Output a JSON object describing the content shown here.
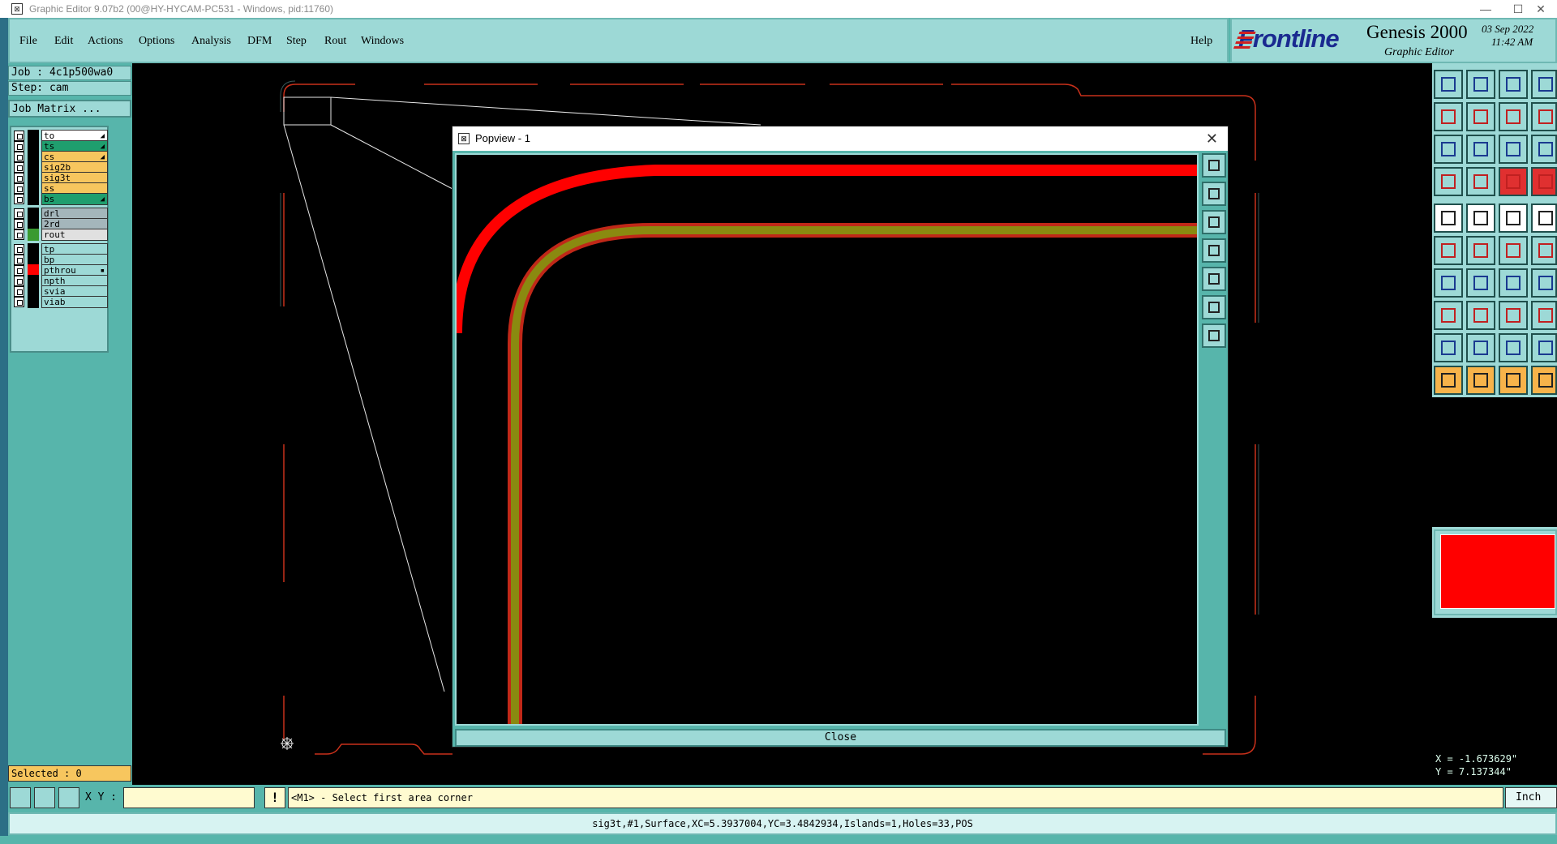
{
  "window": {
    "title": "Graphic Editor 9.07b2 (00@HY-HYCAM-PC531 - Windows, pid:11760)",
    "minimize": "—",
    "maximize": "☐",
    "close": "✕"
  },
  "menu": {
    "items": [
      "File",
      "Edit",
      "Actions",
      "Options",
      "Analysis",
      "DFM",
      "Step",
      "Rout",
      "Windows"
    ],
    "help": "Help"
  },
  "brand": {
    "logo": "Frontline",
    "product": "Genesis 2000",
    "subtitle": "Graphic Editor",
    "date": "03  Sep  2022",
    "time": "11:42  AM"
  },
  "job": {
    "job_label": "Job  : 4c1p500wa0",
    "step_label": "Step: cam",
    "matrix_button": "Job Matrix ..."
  },
  "layers": [
    {
      "name": "to",
      "bg": "#ffffff",
      "swatch": "#000000",
      "mark": "◢"
    },
    {
      "name": "ts",
      "bg": "#1f9e6e",
      "swatch": "#000000",
      "mark": "◢"
    },
    {
      "name": "cs",
      "bg": "#f7c65e",
      "swatch": "#000000",
      "mark": "◢"
    },
    {
      "name": "sig2b",
      "bg": "#f7c65e",
      "swatch": "#000000",
      "mark": ""
    },
    {
      "name": "sig3t",
      "bg": "#f7c65e",
      "swatch": "#000000",
      "mark": ""
    },
    {
      "name": "ss",
      "bg": "#f7c65e",
      "swatch": "#000000",
      "mark": ""
    },
    {
      "name": "bs",
      "bg": "#1f9e6e",
      "swatch": "#000000",
      "mark": "◢"
    },
    {
      "name": "drl",
      "bg": "#a4b6bb",
      "swatch": "#000000",
      "mark": ""
    },
    {
      "name": "2rd",
      "bg": "#a4b6bb",
      "swatch": "#000000",
      "mark": ""
    },
    {
      "name": "rout",
      "bg": "#e0e0e0",
      "swatch": "#3a9a30",
      "mark": ""
    },
    {
      "name": "tp",
      "bg": "#9dd9d6",
      "swatch": "#000000",
      "mark": ""
    },
    {
      "name": "bp",
      "bg": "#9dd9d6",
      "swatch": "#000000",
      "mark": ""
    },
    {
      "name": "pthrou",
      "bg": "#9dd9d6",
      "swatch": "#ff0000",
      "mark": "▪"
    },
    {
      "name": "npth",
      "bg": "#9dd9d6",
      "swatch": "#000000",
      "mark": ""
    },
    {
      "name": "svia",
      "bg": "#9dd9d6",
      "swatch": "#000000",
      "mark": ""
    },
    {
      "name": "viab",
      "bg": "#9dd9d6",
      "swatch": "#000000",
      "mark": ""
    }
  ],
  "selected": "Selected : 0",
  "popview": {
    "title": "Popview - 1",
    "close_label": "Close"
  },
  "coords": {
    "x": "X = -1.673629\"",
    "y": "Y = 7.137344\""
  },
  "command": {
    "xy_label": "X Y :",
    "xy_value": "",
    "exclaim": "!",
    "prompt": "<M1> - Select first area corner",
    "unit": "Inch"
  },
  "status": "sig3t,#1,Surface,XC=5.3937004,YC=3.4842934,Islands=1,Holes=33,POS",
  "colors": {
    "accent": "#57b5ab",
    "panel": "#9dd9d6",
    "trace_red": "#ff0000",
    "trace_olive": "#8a8a10",
    "outline": "#c8301a"
  }
}
